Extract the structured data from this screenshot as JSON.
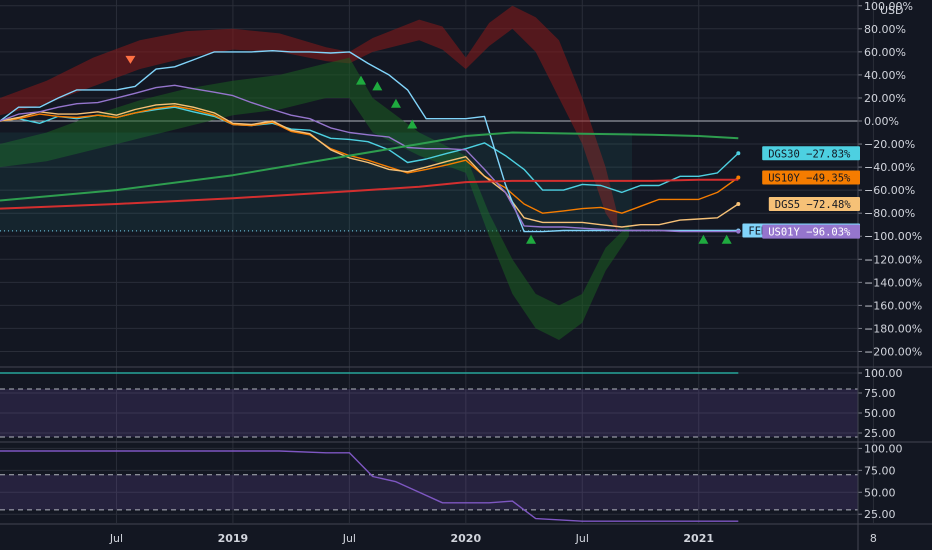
{
  "unit_label": "USD",
  "chart_data": [
    {
      "type": "line",
      "panel": "main",
      "title": "",
      "ylim": [
        -210,
        105
      ],
      "y_ticks": [
        "100.00%",
        "80.00%",
        "60.00%",
        "40.00%",
        "20.00%",
        "0.00%",
        "−20.00%",
        "−40.00%",
        "−60.00%",
        "−80.00%",
        "−100.00%",
        "−120.00%",
        "−140.00%",
        "−160.00%",
        "−180.00%",
        "−200.00%"
      ],
      "y_tick_values": [
        100,
        80,
        60,
        40,
        20,
        0,
        -20,
        -40,
        -60,
        -80,
        -100,
        -120,
        -140,
        -160,
        -180,
        -200
      ],
      "x_ticks": [
        "Jul",
        "2019",
        "Jul",
        "2020",
        "Jul",
        "2021",
        "8"
      ],
      "x_tick_values": [
        0.5,
        1.0,
        1.5,
        2.0,
        2.5,
        3.0,
        3.75
      ],
      "x_major_ticks": [
        "2019",
        "2020",
        "2021"
      ],
      "grid": true,
      "series": [
        {
          "name": "DGS30",
          "color": "#4dd0e1",
          "last_label": "DGS30 −27.83%",
          "x": [
            0,
            0.08,
            0.17,
            0.25,
            0.33,
            0.42,
            0.5,
            0.58,
            0.67,
            0.75,
            0.83,
            0.92,
            1.0,
            1.08,
            1.17,
            1.25,
            1.33,
            1.42,
            1.5,
            1.58,
            1.67,
            1.75,
            1.83,
            1.92,
            2.0,
            2.08,
            2.17,
            2.25,
            2.33,
            2.42,
            2.5,
            2.58,
            2.67,
            2.75,
            2.83,
            2.92,
            3.0,
            3.08,
            3.17
          ],
          "y": [
            0,
            2,
            -2,
            4,
            2,
            5,
            3,
            7,
            10,
            12,
            8,
            4,
            -3,
            -4,
            -2,
            -7,
            -8,
            -15,
            -16,
            -18,
            -25,
            -36,
            -33,
            -28,
            -24,
            -19,
            -30,
            -42,
            -60,
            -60,
            -55,
            -56,
            -62,
            -56,
            -56,
            -48,
            -48,
            -45,
            -28
          ]
        },
        {
          "name": "US10Y",
          "color": "#f57c00",
          "last_label": "US10Y −49.35%",
          "x": [
            0,
            0.08,
            0.17,
            0.25,
            0.33,
            0.42,
            0.5,
            0.58,
            0.67,
            0.75,
            0.83,
            0.92,
            1.0,
            1.08,
            1.17,
            1.25,
            1.33,
            1.42,
            1.5,
            1.58,
            1.67,
            1.75,
            1.83,
            1.92,
            2.0,
            2.08,
            2.17,
            2.25,
            2.33,
            2.42,
            2.5,
            2.58,
            2.67,
            2.75,
            2.83,
            2.92,
            3.0,
            3.08,
            3.17
          ],
          "y": [
            0,
            2,
            6,
            4,
            3,
            5,
            3,
            7,
            11,
            13,
            10,
            5,
            -3,
            -4,
            -1,
            -9,
            -12,
            -24,
            -30,
            -34,
            -40,
            -45,
            -42,
            -38,
            -34,
            -48,
            -58,
            -72,
            -80,
            -78,
            -76,
            -75,
            -80,
            -74,
            -68,
            -68,
            -68,
            -62,
            -49
          ]
        },
        {
          "name": "DGS5",
          "color": "#f6c177",
          "last_label": "DGS5 −72.48%",
          "x": [
            0,
            0.08,
            0.17,
            0.25,
            0.33,
            0.42,
            0.5,
            0.58,
            0.67,
            0.75,
            0.83,
            0.92,
            1.0,
            1.08,
            1.17,
            1.25,
            1.33,
            1.42,
            1.5,
            1.58,
            1.67,
            1.75,
            1.83,
            1.92,
            2.0,
            2.08,
            2.17,
            2.25,
            2.33,
            2.42,
            2.5,
            2.58,
            2.67,
            2.75,
            2.83,
            2.92,
            3.0,
            3.08,
            3.17
          ],
          "y": [
            0,
            3,
            8,
            6,
            6,
            8,
            5,
            10,
            14,
            15,
            12,
            7,
            -2,
            -3,
            0,
            -8,
            -11,
            -25,
            -32,
            -36,
            -42,
            -44,
            -40,
            -35,
            -31,
            -48,
            -62,
            -84,
            -88,
            -88,
            -88,
            -90,
            -92,
            -90,
            -90,
            -86,
            -85,
            -84,
            -72
          ]
        },
        {
          "name": "FEDFUNDS",
          "color": "#81d4fa",
          "last_label": "FEDFUNDS −95.36%",
          "x": [
            0,
            0.08,
            0.17,
            0.25,
            0.33,
            0.42,
            0.5,
            0.58,
            0.67,
            0.75,
            0.83,
            0.92,
            1.0,
            1.08,
            1.17,
            1.25,
            1.33,
            1.42,
            1.5,
            1.58,
            1.67,
            1.75,
            1.83,
            1.92,
            2.0,
            2.08,
            2.17,
            2.25,
            2.33,
            2.42,
            2.5,
            2.58,
            2.67,
            2.75,
            2.83,
            2.92,
            3.0,
            3.08,
            3.17
          ],
          "y": [
            0,
            12,
            12,
            20,
            27,
            27,
            27,
            30,
            45,
            47,
            53,
            60,
            60,
            60,
            61,
            60,
            60,
            59,
            60,
            50,
            40,
            27,
            2,
            2,
            2,
            4,
            -55,
            -96,
            -96,
            -95,
            -95,
            -95,
            -95,
            -95,
            -95,
            -95,
            -95,
            -95,
            -95
          ]
        },
        {
          "name": "US01Y",
          "color": "#9575cd",
          "last_label": "US01Y −96.03%",
          "x": [
            0,
            0.08,
            0.17,
            0.25,
            0.33,
            0.42,
            0.5,
            0.58,
            0.67,
            0.75,
            0.83,
            0.92,
            1.0,
            1.08,
            1.17,
            1.25,
            1.33,
            1.42,
            1.5,
            1.58,
            1.67,
            1.75,
            1.83,
            1.92,
            2.0,
            2.08,
            2.17,
            2.25,
            2.33,
            2.42,
            2.5,
            2.58,
            2.67,
            2.75,
            2.83,
            2.92,
            3.0,
            3.08,
            3.17
          ],
          "y": [
            0,
            6,
            8,
            12,
            15,
            16,
            20,
            24,
            29,
            31,
            28,
            25,
            22,
            16,
            10,
            5,
            2,
            -6,
            -10,
            -12,
            -14,
            -23,
            -24,
            -24,
            -25,
            -42,
            -62,
            -91,
            -92,
            -92,
            -93,
            -94,
            -95,
            -95,
            -95,
            -96,
            -96,
            -96,
            -96
          ]
        },
        {
          "name": "ma-green-slow",
          "color": "#2e9e4f",
          "x": [
            0,
            0.5,
            1.0,
            1.5,
            1.8,
            2.0,
            2.2,
            2.5,
            2.8,
            3.0,
            3.17
          ],
          "y": [
            -69,
            -60,
            -47,
            -30,
            -20,
            -13,
            -10,
            -11,
            -12,
            -13,
            -15
          ]
        },
        {
          "name": "ma-red-slow",
          "color": "#d32f2f",
          "x": [
            0,
            0.5,
            1.0,
            1.5,
            1.8,
            2.0,
            2.2,
            2.5,
            2.8,
            3.0,
            3.17
          ],
          "y": [
            -76,
            -72,
            -67,
            -61,
            -57,
            -53,
            -52,
            -52,
            -52,
            -51,
            -51
          ]
        }
      ],
      "bands": [
        {
          "name": "red-cloud",
          "color": "#8b1a1a",
          "x": [
            0,
            0.2,
            0.4,
            0.6,
            0.8,
            1.0,
            1.2,
            1.4,
            1.5,
            1.6,
            1.8,
            1.9,
            2.0,
            2.1,
            2.2,
            2.3,
            2.4,
            2.5,
            2.55,
            2.6,
            2.65
          ],
          "upper": [
            20,
            35,
            55,
            70,
            78,
            80,
            76,
            64,
            60,
            72,
            88,
            82,
            55,
            85,
            100,
            90,
            70,
            20,
            -10,
            -40,
            -80
          ],
          "lower": [
            5,
            15,
            30,
            45,
            55,
            62,
            60,
            52,
            50,
            60,
            70,
            62,
            45,
            65,
            80,
            60,
            20,
            -20,
            -50,
            -80,
            -95
          ]
        },
        {
          "name": "green-cloud",
          "color": "#1b5e20",
          "x": [
            0,
            0.2,
            0.4,
            0.6,
            0.8,
            1.0,
            1.2,
            1.4,
            1.5,
            1.6,
            1.8,
            2.0,
            2.1,
            2.2,
            2.3,
            2.4,
            2.5,
            2.6,
            2.7
          ],
          "upper": [
            -20,
            -10,
            5,
            18,
            28,
            35,
            40,
            50,
            55,
            20,
            -10,
            -30,
            -80,
            -120,
            -150,
            -160,
            -150,
            -110,
            -90
          ],
          "lower": [
            -40,
            -35,
            -25,
            -15,
            -5,
            5,
            10,
            20,
            20,
            -10,
            -30,
            -45,
            -100,
            -150,
            -180,
            -190,
            -175,
            -130,
            -100
          ]
        }
      ],
      "arrows_up": [
        [
          1.55,
          35
        ],
        [
          1.62,
          30
        ],
        [
          1.7,
          15
        ],
        [
          1.77,
          -3
        ],
        [
          2.28,
          -103
        ],
        [
          3.02,
          -103
        ],
        [
          3.12,
          -103
        ]
      ],
      "arrows_down": [
        [
          0.56,
          53
        ]
      ],
      "dotted_level": -95.36
    },
    {
      "type": "line",
      "panel": "oscillator-1",
      "ylim": [
        15,
        105
      ],
      "y_ticks": [
        "100.00",
        "75.00",
        "50.00",
        "25.00"
      ],
      "y_tick_values": [
        100,
        75,
        50,
        25
      ],
      "band": [
        20,
        80
      ],
      "series": [
        {
          "name": "osc-1",
          "color": "#26a69a",
          "x": [
            0,
            3.17
          ],
          "y": [
            100,
            100
          ]
        }
      ]
    },
    {
      "type": "line",
      "panel": "oscillator-2",
      "ylim": [
        15,
        105
      ],
      "y_ticks": [
        "100.00",
        "75.00",
        "50.00",
        "25.00"
      ],
      "y_tick_values": [
        100,
        75,
        50,
        25
      ],
      "band": [
        30,
        70
      ],
      "series": [
        {
          "name": "osc-2",
          "color": "#7e57c2",
          "x": [
            0,
            0.5,
            1.0,
            1.2,
            1.4,
            1.5,
            1.6,
            1.7,
            1.8,
            1.9,
            2.0,
            2.1,
            2.2,
            2.3,
            2.5,
            2.8,
            3.0,
            3.17
          ],
          "y": [
            97,
            97,
            97,
            97,
            95,
            95,
            68,
            62,
            50,
            38,
            38,
            38,
            40,
            20,
            17,
            17,
            17,
            17
          ]
        }
      ]
    }
  ]
}
